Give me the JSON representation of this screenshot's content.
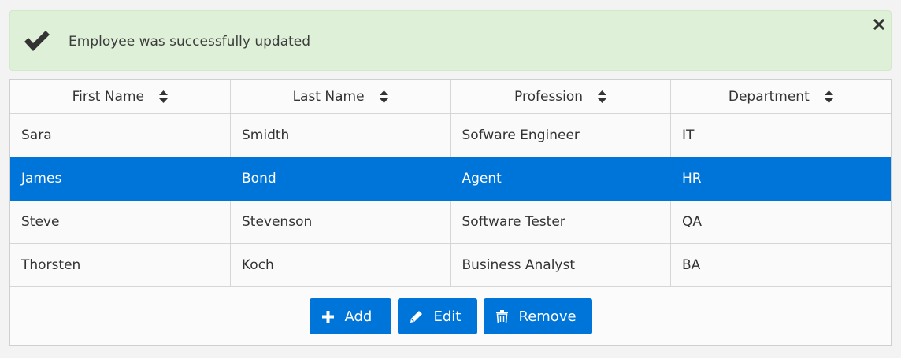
{
  "alert": {
    "message": "Employee was successfully updated",
    "icon": "check-icon",
    "close_icon": "close-icon",
    "color": "#dff0d8"
  },
  "table": {
    "columns": [
      "First Name",
      "Last Name",
      "Profession",
      "Department"
    ],
    "rows": [
      [
        "Sara",
        "Smidth",
        "Sofware Engineer",
        "IT"
      ],
      [
        "James",
        "Bond",
        "Agent",
        "HR"
      ],
      [
        "Steve",
        "Stevenson",
        "Software Tester",
        "QA"
      ],
      [
        "Thorsten",
        "Koch",
        "Business Analyst",
        "BA"
      ]
    ],
    "selected_row": 1,
    "selected_color": "#0075d9"
  },
  "toolbar": {
    "add_label": "Add",
    "edit_label": "Edit",
    "remove_label": "Remove",
    "button_color": "#0075d9"
  }
}
